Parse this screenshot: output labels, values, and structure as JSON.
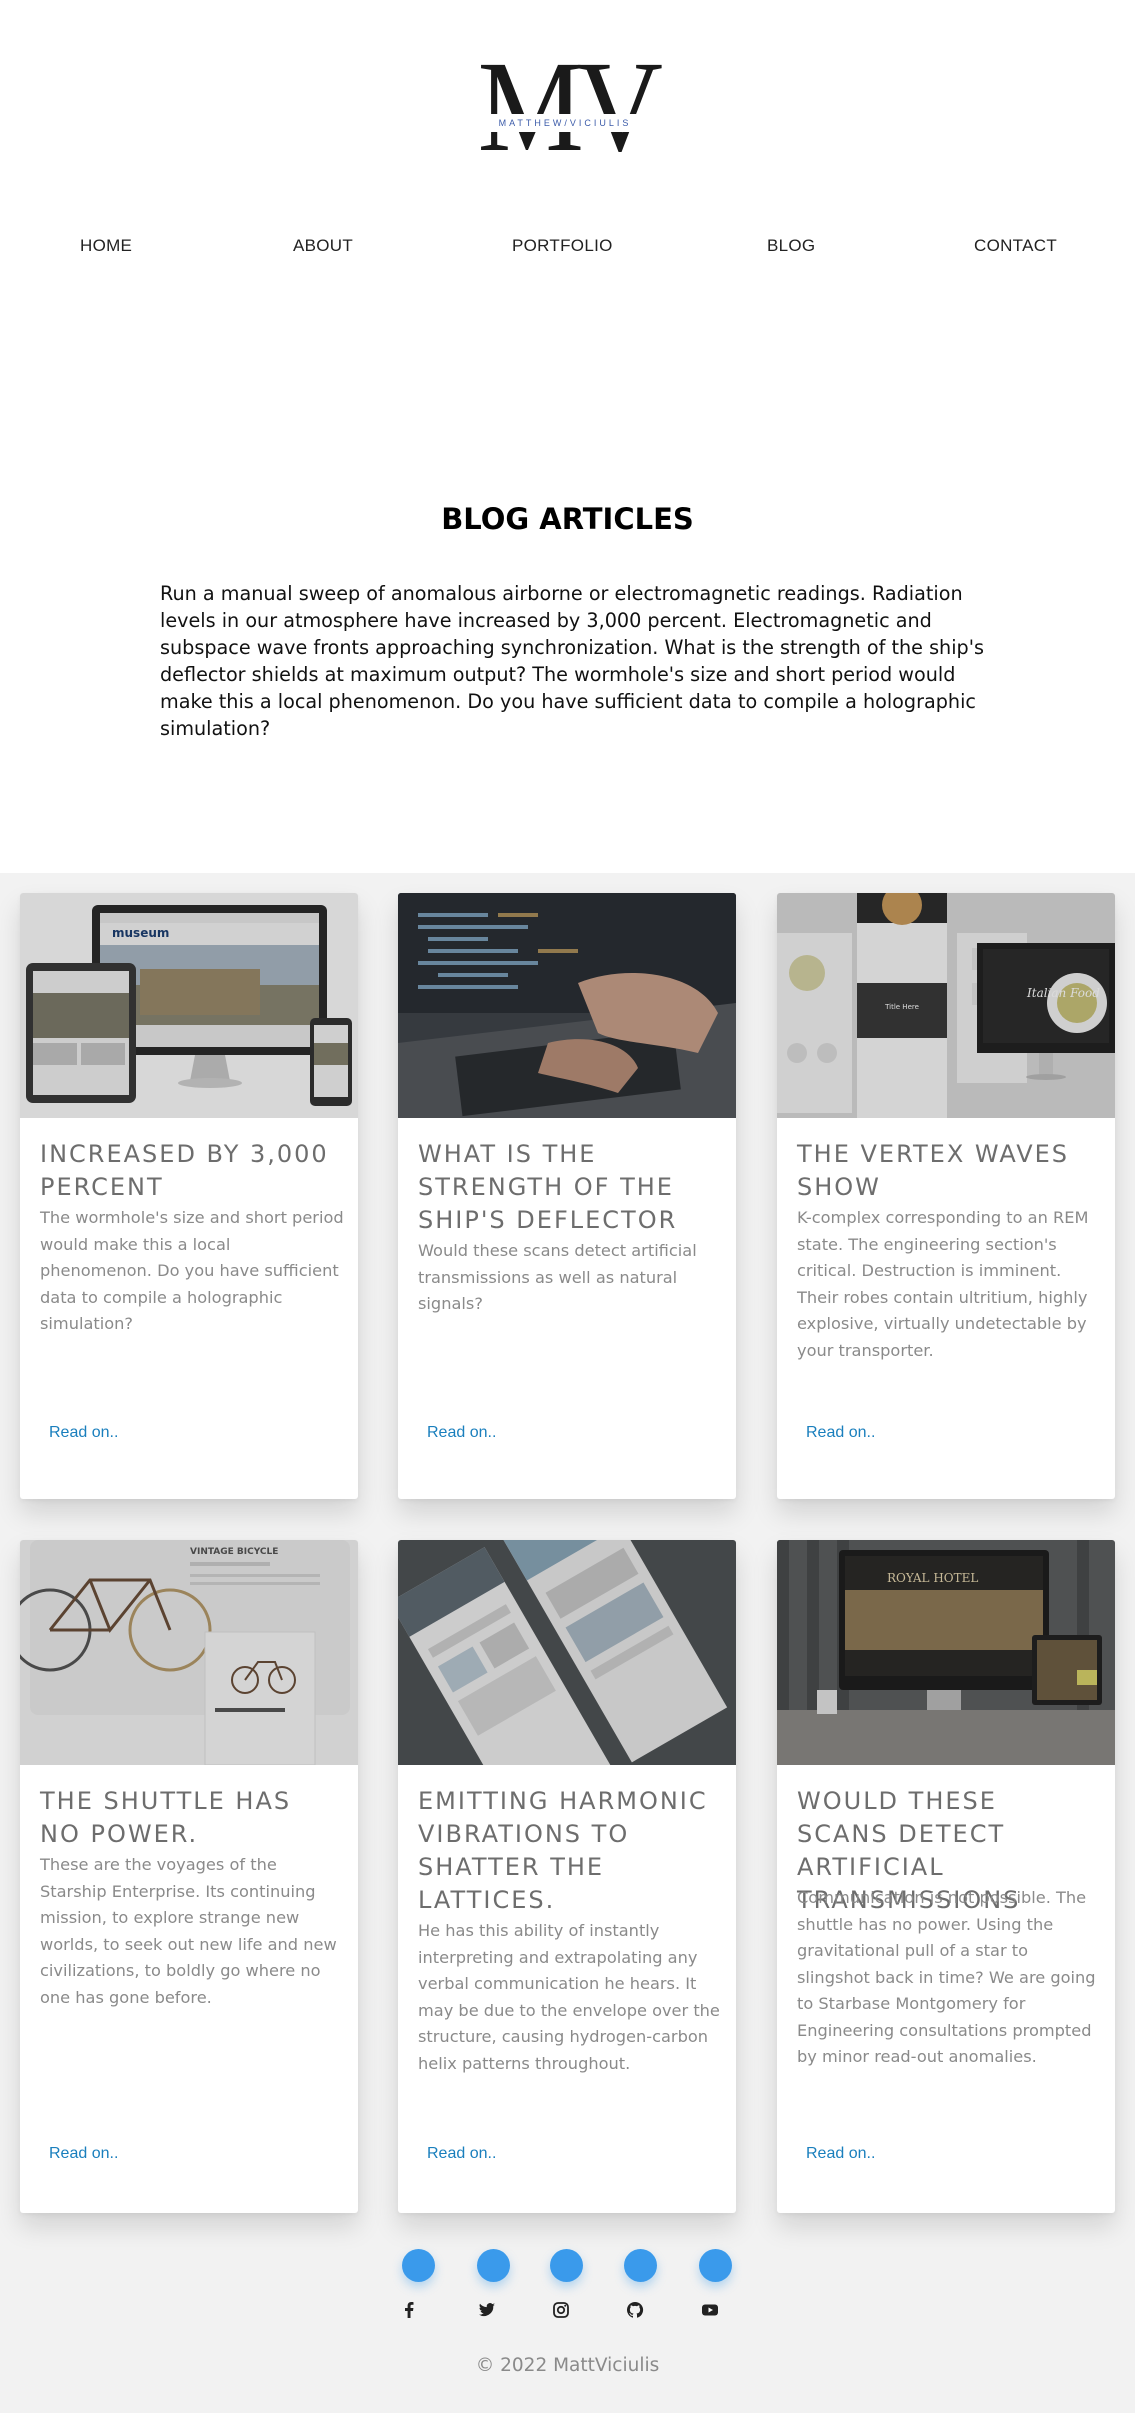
{
  "logo": {
    "letters": "MV",
    "subtitle": "MATTHEW/VICIULIS"
  },
  "nav": {
    "items": [
      {
        "label": "HOME"
      },
      {
        "label": "ABOUT"
      },
      {
        "label": "PORTFOLIO"
      },
      {
        "label": "BLOG"
      },
      {
        "label": "CONTACT"
      }
    ]
  },
  "intro": {
    "title": "BLOG ARTICLES",
    "text": "Run a manual sweep of anomalous airborne or electromagnetic readings. Radiation levels in our atmosphere have increased by 3,000 percent. Electromagnetic and subspace wave fronts approaching synchronization. What is the strength of the ship's deflector shields at maximum output? The wormhole's size and short period would make this a local phenomenon. Do you have sufficient data to compile a holographic simulation?"
  },
  "articles": [
    {
      "title": "INCREASED BY 3,000 PERCENT",
      "excerpt": "The wormhole's size and short period would make this a local phenomenon. Do you have sufficient data to compile a holographic simulation?",
      "link": "Read on..",
      "image": "museum-responsive-mockup"
    },
    {
      "title": "WHAT IS THE STRENGTH OF THE SHIP'S DEFLECTOR",
      "excerpt": "Would these scans detect artificial transmissions as well as natural signals?",
      "link": "Read on..",
      "image": "laptop-typing"
    },
    {
      "title": "THE VERTEX WAVES SHOW",
      "excerpt": "K-complex corresponding to an REM state. The engineering section's critical. Destruction is imminent. Their robes contain ultritium, highly explosive, virtually undetectable by your transporter.",
      "link": "Read on..",
      "image": "italian-food-mockup"
    },
    {
      "title": "THE SHUTTLE HAS NO POWER.",
      "excerpt": "These are the voyages of the Starship Enterprise. Its continuing mission, to explore strange new worlds, to seek out new life and new civilizations, to boldly go where no one has gone before.",
      "link": "Read on..",
      "image": "vintage-bicycle-mockup"
    },
    {
      "title": "EMITTING HARMONIC VIBRATIONS TO SHATTER THE LATTICES.",
      "excerpt": "He has this ability of instantly interpreting and extrapolating any verbal communication he hears. It may be due to the envelope over the structure, causing hydrogen-carbon helix patterns throughout.",
      "link": "Read on..",
      "image": "web-pages-mockup"
    },
    {
      "title": "WOULD THESE SCANS DETECT ARTIFICIAL TRANSMISSIONS",
      "excerpt": "Communication is not possible. The shuttle has no power. Using the gravitational pull of a star to slingshot back in time? We are going to Starbase Montgomery for Engineering consultations prompted by minor read-out anomalies.",
      "link": "Read on..",
      "image": "royal-hotel-mockup"
    }
  ],
  "mockup_text": {
    "museum": "museum",
    "title_here": "Title Here",
    "italian_food": "Italian Food",
    "vintage_bicycle": "VINTAGE BICYCLE",
    "royal_hotel": "ROYAL HOTEL"
  },
  "social": {
    "icons": [
      "facebook-icon",
      "twitter-icon",
      "instagram-icon",
      "github-icon",
      "youtube-icon"
    ],
    "accent": "#3a9aeb"
  },
  "footer": {
    "copyright": "© 2022 MattViciulis"
  },
  "colors": {
    "section_bg": "#f2f2f2",
    "link": "#1a7fbd",
    "heading_muted": "#6d6d6d"
  }
}
